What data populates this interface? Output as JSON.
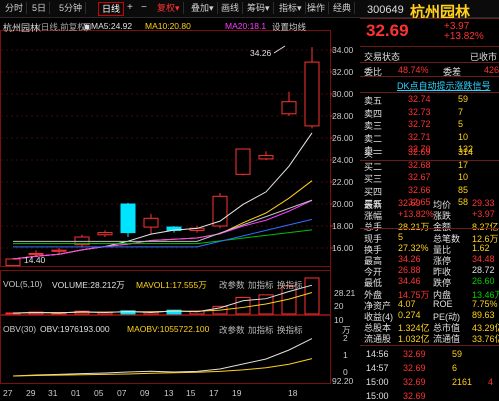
{
  "toolbar": {
    "items": [
      "分时",
      "5日",
      "5分钟",
      "日线",
      "复权",
      "叠加",
      "画线",
      "筹码",
      "指标",
      "操作",
      "经典"
    ]
  },
  "stock": {
    "code": "300649",
    "name": "杭州园林",
    "price": "32.69",
    "change": "+3.97",
    "change_pct": "+13.82%"
  },
  "chart": {
    "title": "杭州园林",
    "subtitle": "(日线,前复权)",
    "ma5": "MA5:24.92",
    "ma10": "MA10:20.80",
    "ma20": "MA20:18.1",
    "settings": "设置均线",
    "high_label": "34.26",
    "low_label": "14.40",
    "price_ticks": [
      "34.00",
      "32.00",
      "30.00",
      "28.00",
      "26.00",
      "24.00",
      "22.00",
      "20.00",
      "18.00",
      "16.00"
    ],
    "vol_header": [
      "VOL(5,10)",
      "VOLUME:28.212万",
      "MAVOL1:17.555万",
      "改参数",
      "加指标",
      "换指标"
    ],
    "vol_ticks": [
      "28.21",
      "20",
      "10"
    ],
    "vol_unit": "万",
    "obv_header": [
      "OBV(30)",
      "OBV:1976193.000",
      "MAOBV:1055722.100",
      "改参数",
      "加指标",
      "换指标"
    ],
    "obv_ticks": [
      "2",
      "1",
      "0"
    ],
    "obv_low": "92.20",
    "x_ticks": [
      "27",
      "29",
      "31",
      "01",
      "05",
      "07",
      "09",
      "13",
      "15",
      "17",
      "19"
    ],
    "x_last": "18"
  },
  "chart_data": {
    "type": "candlestick",
    "candles": [
      {
        "open": 14.4,
        "close": 15.0,
        "high": 15.1,
        "low": 14.4
      },
      {
        "open": 15.4,
        "close": 15.5,
        "high": 15.8,
        "low": 15.2
      },
      {
        "open": 15.7,
        "close": 15.8,
        "high": 16.0,
        "low": 15.5
      },
      {
        "open": 16.3,
        "close": 17.0,
        "high": 17.2,
        "low": 16.1
      },
      {
        "open": 17.2,
        "close": 17.4,
        "high": 17.6,
        "low": 17.0
      },
      {
        "open": 20.0,
        "close": 17.4,
        "high": 20.1,
        "low": 17.0
      },
      {
        "open": 17.9,
        "close": 18.7,
        "high": 19.1,
        "low": 17.3
      },
      {
        "open": 17.9,
        "close": 17.6,
        "high": 18.0,
        "low": 17.4
      },
      {
        "open": 17.6,
        "close": 17.8,
        "high": 18.0,
        "low": 17.4
      },
      {
        "open": 18.0,
        "close": 20.7,
        "high": 21.0,
        "low": 17.8
      },
      {
        "open": 22.7,
        "close": 25.0,
        "high": 25.0,
        "low": 22.6
      },
      {
        "open": 24.1,
        "close": 24.4,
        "high": 24.8,
        "low": 24.0
      },
      {
        "open": 28.2,
        "close": 29.3,
        "high": 30.2,
        "low": 28.0
      },
      {
        "open": 27.1,
        "close": 32.9,
        "high": 34.26,
        "low": 26.88
      }
    ],
    "volume": [
      0.8,
      1.5,
      1.0,
      2.2,
      1.5,
      2.5,
      1.5,
      3.0,
      2.2,
      6.0,
      13.0,
      15.0,
      22.0,
      28.21
    ],
    "obv": [
      0.1,
      0.15,
      0.18,
      0.22,
      0.25,
      0.3,
      0.34,
      0.3,
      0.33,
      0.45,
      0.7,
      0.95,
      1.4,
      1.97
    ],
    "ylim": [
      14.0,
      35.0
    ]
  },
  "orderbook": {
    "ratio_label": "委比",
    "ratio": "48.74%",
    "diff_label": "委差",
    "diff": "426",
    "header_left": "交易状态",
    "header_right": "已收市",
    "signal": "DK点自动提示涨跌信号",
    "asks": [
      {
        "label": "卖五",
        "price": "32.74",
        "vol": "59"
      },
      {
        "label": "卖四",
        "price": "32.73",
        "vol": "7"
      },
      {
        "label": "卖三",
        "price": "32.72",
        "vol": "5"
      },
      {
        "label": "卖二",
        "price": "32.71",
        "vol": "10"
      },
      {
        "label": "卖一",
        "price": "32.70",
        "vol": "132"
      }
    ],
    "bids": [
      {
        "label": "买一",
        "price": "32.69",
        "vol": "314"
      },
      {
        "label": "买二",
        "price": "32.68",
        "vol": "17"
      },
      {
        "label": "买三",
        "price": "32.67",
        "vol": "10"
      },
      {
        "label": "买四",
        "price": "32.66",
        "vol": "85"
      },
      {
        "label": "买五",
        "price": "32.65",
        "vol": "58"
      }
    ]
  },
  "stats": [
    {
      "l": "最新",
      "v": "32.69",
      "l2": "均价",
      "v2": "29.33"
    },
    {
      "l": "涨幅",
      "v": "+13.82%",
      "l2": "涨跌",
      "v2": "+3.97"
    },
    {
      "l": "总手",
      "v": "28.21万",
      "l2": "金额",
      "v2": "8.27亿"
    },
    {
      "l": "现手",
      "v": "5",
      "l2": "总笔数",
      "v2": "12.6万"
    },
    {
      "l": "换手",
      "v": "27.32%",
      "l2": "量比",
      "v2": "1.62"
    },
    {
      "l": "最高",
      "v": "34.26",
      "l2": "涨停",
      "v2": "34.48"
    },
    {
      "l": "今开",
      "v": "26.88",
      "l2": "昨收",
      "v2": "28.72"
    },
    {
      "l": "最低",
      "v": "34.46",
      "l2": "跌停",
      "v2": "26.60"
    },
    {
      "l": "外盘",
      "v": "14.75万",
      "l2": "内盘",
      "v2": "13.46万"
    },
    {
      "l": "净资产",
      "v": "4.07",
      "l2": "ROE",
      "v2": "7.75%"
    },
    {
      "l": "收益(4)",
      "v": "0.274",
      "l2": "PE(动)",
      "v2": "89.63"
    },
    {
      "l": "总股本",
      "v": "1.324亿",
      "l2": "总市值",
      "v2": "43.29亿"
    },
    {
      "l": "流通股",
      "v": "1.032亿",
      "l2": "流通值",
      "v2": "33.76亿"
    }
  ],
  "ticks": [
    {
      "time": "14:56",
      "price": "32.69",
      "vol": "59",
      "n": ""
    },
    {
      "time": "14:57",
      "price": "32.69",
      "vol": "6",
      "n": ""
    },
    {
      "time": "15:00",
      "price": "32.69",
      "vol": "2161",
      "n": "4"
    },
    {
      "time": "15:00",
      "price": "32.69",
      "vol": "",
      "n": ""
    }
  ]
}
